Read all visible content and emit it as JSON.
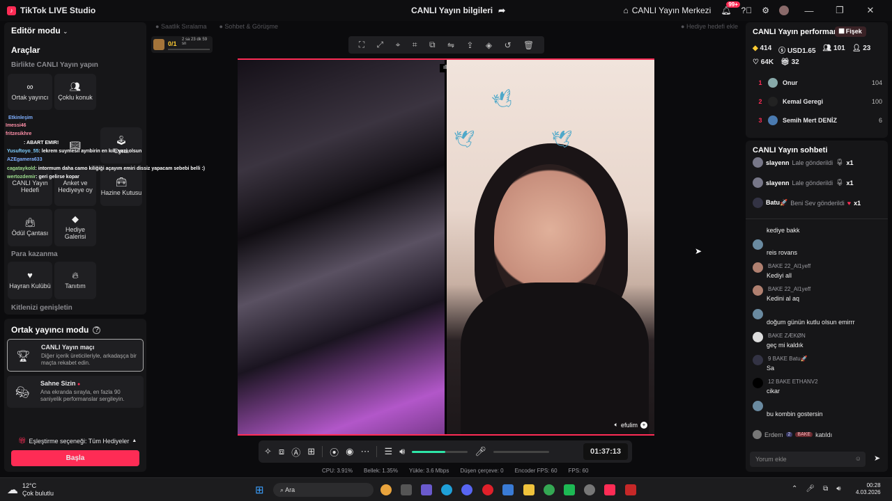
{
  "titlebar": {
    "app_name": "TikTok LIVE Studio",
    "center_title": "CANLI Yayın bilgileri",
    "live_center": "CANLI Yayın Merkezi",
    "notif_count": "99+"
  },
  "left": {
    "mode_label": "Editör modu",
    "tools_title": "Araçlar",
    "together_label": "Birlikte CANLI Yayın yapın",
    "tool_cohost": "Ortak yayıncı",
    "tool_multi": "Çoklu konuk",
    "tool_goal": "CANLI Yayın Hedefi",
    "tool_poll": "Anket ve Hediyeye oy",
    "tool_treasure": "Hazine Kutusu",
    "tool_reward": "Ödül Çantası",
    "tool_gallery": "Hediye Galerisi",
    "tool_play": "Oyna",
    "monetize_label": "Para kazanma",
    "tool_fanclub": "Hayran Kulübü",
    "tool_promo": "Tanıtım",
    "audience_label": "Kitlenizi genişletin",
    "cohost_mode_title": "Ortak yayıncı modu",
    "match_title": "CANLI Yayın maçı",
    "match_desc": "Diğer içerik üreticileriyle, arkadaşça bir maçta rekabet edin.",
    "stage_title": "Sahne Sizin",
    "stage_desc": "Ana ekranda sırayla, en fazla 90 saniyelik performanslar sergileyin.",
    "match_option": "Eşleştirme seçeneği: Tüm Hediyeler",
    "start_button": "Başla"
  },
  "overlay_chat": [
    {
      "user": "Etkinleşim",
      "text": ""
    },
    {
      "user": "Imessi46",
      "text": ""
    },
    {
      "user": "fritzesikhre",
      "text": ""
    },
    {
      "user": "",
      "text": ": ABART EMIR!"
    },
    {
      "user": "Yusuftoyo_55",
      "text": ": lekrem suymesil ayrıbirin en kıllı yazi olsun"
    },
    {
      "user": "AZEgamera633",
      "text": ""
    },
    {
      "user": "cagataykold",
      "text": ": intormum daha camo kiliğiği açayım emiri dissiz yapacam sebebi belli :)"
    },
    {
      "user": "wertozdemir",
      "text": ": geri gelirse kopar"
    }
  ],
  "stage": {
    "top_tab_1": "Saatlik Sıralama",
    "top_tab_2": "Sohbet & Görüşme",
    "gift_goal": "Hediye hedefi ekle",
    "progress_count": "0/1",
    "progress_time": "2 sa 23 dk 59 sn",
    "progress_fraction": 0.0,
    "guest_name": "efulim",
    "timer": "01:37:13",
    "volume_fraction": 0.6
  },
  "stats": {
    "cpu": "CPU: 3.91%",
    "memory": "Bellek: 1.35%",
    "upload": "Yükle: 3.6 Mbps",
    "dropped": "Düşen çerçeve: 0",
    "encoder_fps": "Encoder FPS: 60",
    "fps": "FPS: 60"
  },
  "performance": {
    "title": "CANLI Yayın performansı",
    "fire_badge": "Fişek",
    "coins": "414",
    "usd": "USD1.65",
    "viewers": "101",
    "new_followers": "23",
    "likes": "64K",
    "gifters": "32",
    "ranking": [
      {
        "rank": "1",
        "name": "Onur",
        "score": "104"
      },
      {
        "rank": "2",
        "name": "Kemal Geregi",
        "score": "100"
      },
      {
        "rank": "3",
        "name": "Semih Mert DENİZ",
        "score": "6"
      }
    ]
  },
  "chat": {
    "title": "CANLI Yayın sohbeti",
    "gifts": [
      {
        "user": "slayenn",
        "text": "Lale gönderildi",
        "count": "x1"
      },
      {
        "user": "slayenn",
        "text": "Lale gönderildi",
        "count": "x1"
      },
      {
        "user": "Batu🚀",
        "text": "Beni Sev gönderildi",
        "count": "x1"
      }
    ],
    "messages": [
      {
        "header": "",
        "text": "kediye bakk"
      },
      {
        "header": "",
        "text": "reis rovans"
      },
      {
        "header": "BAKE 22_Al1yeff",
        "text": "Kediyi all"
      },
      {
        "header": "BAKE 22_Al1yeff",
        "text": "Kedini al aq"
      },
      {
        "header": "",
        "text": "doğum günün kutlu olsun emirrr"
      },
      {
        "header": "BAKE ZÆKØN",
        "text": "geç mi kaldık"
      },
      {
        "header": "9 BAKE Batu🚀",
        "text": "Sa"
      },
      {
        "header": "12 BAKE ETHANV2",
        "text": "cikar"
      },
      {
        "header": "",
        "text": "bu kombin gostersin"
      }
    ],
    "join_user": "Erdem",
    "join_level": "2",
    "join_text": "katıldı",
    "input_placeholder": "Yorum ekle"
  },
  "taskbar": {
    "weather_temp": "12°C",
    "weather_desc": "Çok bulutlu",
    "search_placeholder": "Ara",
    "time": "00:28",
    "date": "4.03.2026"
  },
  "colors": {
    "accent": "#fe2c55",
    "panel": "#161618",
    "bg": "#0b0b0d"
  }
}
